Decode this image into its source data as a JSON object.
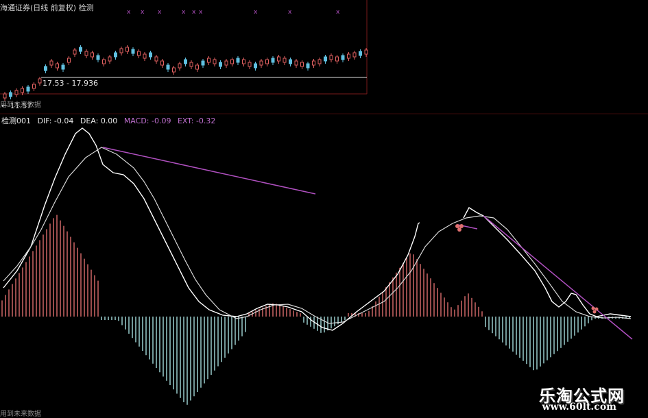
{
  "window": {
    "title": "海通证券(日线 前复权) 检测"
  },
  "price_panel": {
    "range_label": "17.53 - 17.93",
    "range_suffix": "6",
    "low_label": "← 11.57",
    "future_label": "用到未来数据"
  },
  "indicator_panel": {
    "name": "检测001",
    "dif": "DIF: -0.04",
    "dea": "DEA: 0.00",
    "macd": "MACD: -0.09",
    "ext": "EXT: -0.32",
    "future_label": "用到未来数据"
  },
  "watermark": {
    "site_name": "乐淘公式网",
    "url": "www.60lt.com"
  },
  "colors": {
    "background": "#000000",
    "up_bar": "#c06060",
    "down_bar": "#90c0c0",
    "dif_line": "#ffffff",
    "dea_line": "#d0d0d0",
    "trend_line": "#b050c0",
    "signal_marker": "#e07070"
  }
}
